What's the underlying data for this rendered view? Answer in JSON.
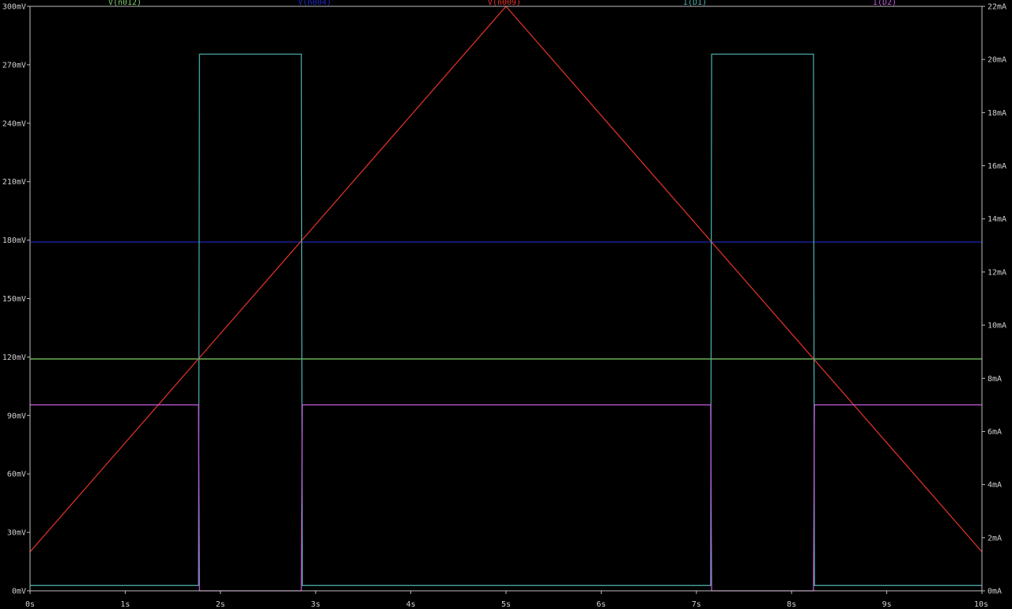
{
  "chart_data": {
    "type": "line",
    "title": "",
    "xlabel": "",
    "ylabel": "",
    "grid": false,
    "legend": "top",
    "x_ticks": [
      "0s",
      "1s",
      "2s",
      "3s",
      "4s",
      "5s",
      "6s",
      "7s",
      "8s",
      "9s",
      "10s"
    ],
    "xlim": [
      0,
      10
    ],
    "left_axis": {
      "unit": "mV",
      "ylim": [
        0,
        300
      ],
      "ticks": [
        "0mV",
        "30mV",
        "60mV",
        "90mV",
        "120mV",
        "150mV",
        "180mV",
        "210mV",
        "240mV",
        "270mV",
        "300mV"
      ]
    },
    "right_axis": {
      "unit": "mA",
      "ylim": [
        0,
        22
      ],
      "ticks": [
        "0mA",
        "2mA",
        "4mA",
        "6mA",
        "8mA",
        "10mA",
        "12mA",
        "14mA",
        "16mA",
        "18mA",
        "20mA",
        "22mA"
      ]
    },
    "series": [
      {
        "name": "V(n012)",
        "color": "#7fd16b",
        "axis": "left",
        "x": [
          0,
          10
        ],
        "y": [
          119,
          119
        ]
      },
      {
        "name": "V(n004)",
        "color": "#1e2bc8",
        "axis": "left",
        "x": [
          0,
          10
        ],
        "y": [
          179,
          179
        ]
      },
      {
        "name": "V(n009)",
        "color": "#e8332a",
        "axis": "left",
        "x": [
          0,
          5,
          10
        ],
        "y": [
          20,
          300,
          20
        ]
      },
      {
        "name": "I(D1)",
        "color": "#4fb3b0",
        "axis": "right",
        "x": [
          0,
          1.77,
          1.78,
          2.85,
          2.86,
          7.15,
          7.16,
          8.23,
          8.24,
          10
        ],
        "y": [
          0.2,
          0.2,
          20.2,
          20.2,
          0.2,
          0.2,
          20.2,
          20.2,
          0.2,
          0.2
        ]
      },
      {
        "name": "I(D2)",
        "color": "#c75adf",
        "axis": "right",
        "x": [
          0,
          1.77,
          1.78,
          2.85,
          2.86,
          7.15,
          7.16,
          8.23,
          8.24,
          10
        ],
        "y": [
          7.0,
          7.0,
          0,
          0,
          7.0,
          7.0,
          0,
          0,
          7.0,
          7.0
        ]
      }
    ]
  }
}
